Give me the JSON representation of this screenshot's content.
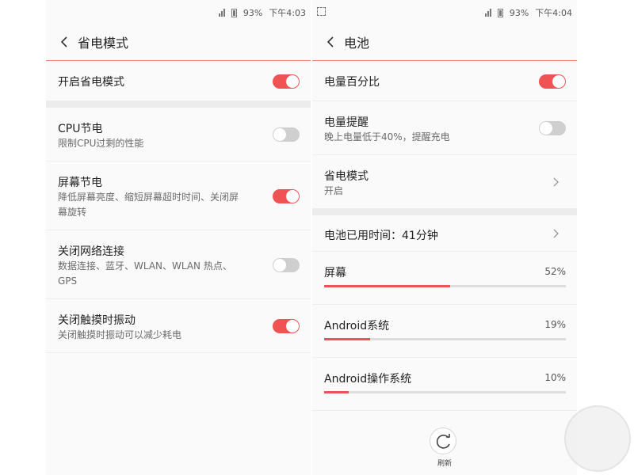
{
  "colors": {
    "accent": "#f05354",
    "divider": "#f3837f",
    "toggle_off": "#cfcfcf",
    "section_gap": "#ececec"
  },
  "left": {
    "status": {
      "battery": "93%",
      "time": "下午4:03"
    },
    "header": {
      "title": "省电模式",
      "back_icon": "chevron-left-icon"
    },
    "master": {
      "label": "开启省电模式",
      "on": true
    },
    "items": [
      {
        "label": "CPU节电",
        "sub1": "限制CPU过剩的性能",
        "sub2": "",
        "on": false
      },
      {
        "label": "屏幕节电",
        "sub1": "降低屏幕亮度、缩短屏幕超时时间、关闭屏",
        "sub2": "幕旋转",
        "on": true
      },
      {
        "label": "关闭网络连接",
        "sub1": "数据连接、蓝牙、WLAN、WLAN 热点、",
        "sub2": "GPS",
        "on": false
      },
      {
        "label": "关闭触摸时振动",
        "sub1": "关闭触摸时振动可以减少耗电",
        "sub2": "",
        "on": true
      }
    ]
  },
  "right": {
    "status": {
      "battery": "93%",
      "time": "下午4:04"
    },
    "header": {
      "title": "电池",
      "back_icon": "chevron-left-icon"
    },
    "battery_percent": {
      "label": "电量百分比",
      "on": true
    },
    "battery_reminder": {
      "label": "电量提醒",
      "sub": "晚上电量低于40%，提醒充电",
      "on": false
    },
    "power_mode": {
      "label": "省电模式",
      "sub": "开启"
    },
    "usage_time": {
      "label": "电池已用时间：41分钟"
    },
    "usage": [
      {
        "label": "屏幕",
        "percent_text": "52%",
        "value": 52
      },
      {
        "label": "Android系统",
        "percent_text": "19%",
        "value": 19
      },
      {
        "label": "Android操作系统",
        "percent_text": "10%",
        "value": 10
      }
    ],
    "refresh": {
      "label": "刷新",
      "icon": "refresh-icon"
    }
  },
  "watermark": {
    "icon": "watermark-logo"
  }
}
